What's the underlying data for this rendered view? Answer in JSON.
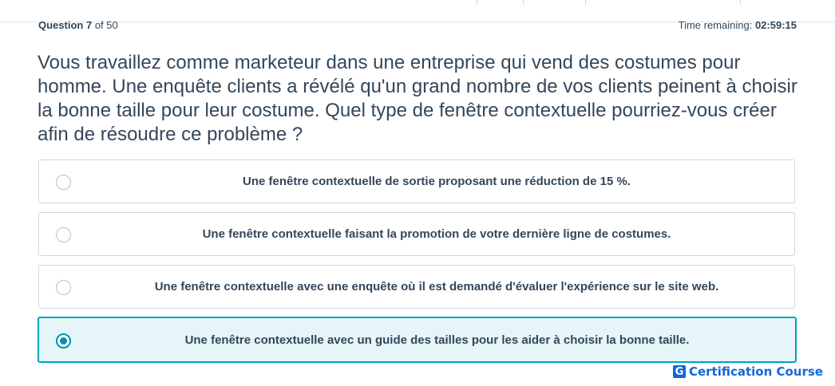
{
  "header": {
    "question_word": "Question",
    "question_number": "7",
    "question_of": "of 50",
    "time_label": "Time remaining:",
    "time_value": "02:59:15"
  },
  "question": {
    "text": "Vous travaillez comme marketeur dans une entreprise qui vend des costumes pour homme. Une enquête clients a révélé qu'un grand nombre de vos clients peinent à choisir la bonne taille pour leur costume. Quel type de fenêtre contextuelle pourriez-vous créer afin de résoudre ce problème ?"
  },
  "options": [
    {
      "label": "Une fenêtre contextuelle de sortie proposant une réduction de 15 %.",
      "selected": false
    },
    {
      "label": "Une fenêtre contextuelle faisant la promotion de votre dernière ligne de costumes.",
      "selected": false
    },
    {
      "label": "Une fenêtre contextuelle avec une enquête où il est demandé d'évaluer l'expérience sur le site web.",
      "selected": false
    },
    {
      "label": "Une fenêtre contextuelle avec un guide des tailles pour les aider à choisir la bonne taille.",
      "selected": true
    }
  ],
  "brand": {
    "logo_letter": "G",
    "name": "Certification Course"
  },
  "colors": {
    "accent": "#00a4bd",
    "text": "#33475b",
    "selected_bg": "#e5f5f8",
    "brand": "#1565d8"
  }
}
